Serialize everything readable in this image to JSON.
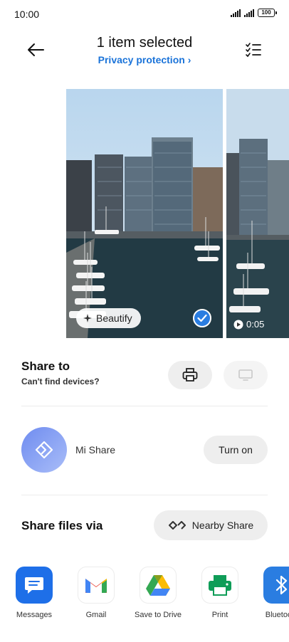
{
  "status_bar": {
    "time": "10:00",
    "battery": "100"
  },
  "header": {
    "title": "1 item selected",
    "subtitle": "Privacy protection",
    "back_icon": "back-arrow-icon",
    "select_all_icon": "checklist-icon"
  },
  "carousel": {
    "items": [
      {
        "type": "photo",
        "selected": true,
        "beautify_label": "Beautify"
      },
      {
        "type": "video",
        "duration": "0:05"
      }
    ]
  },
  "share_to": {
    "title": "Share to",
    "subtitle": "Can't find devices?",
    "print_icon": "printer-icon",
    "cast_icon": "monitor-icon"
  },
  "mi_share": {
    "label": "Mi Share",
    "button": "Turn on"
  },
  "share_files": {
    "title": "Share files via",
    "nearby_button": "Nearby Share"
  },
  "apps": [
    {
      "label": "Messages",
      "icon": "messages-icon"
    },
    {
      "label": "Gmail",
      "icon": "gmail-icon"
    },
    {
      "label": "Save to Drive",
      "icon": "google-drive-icon"
    },
    {
      "label": "Print",
      "icon": "printer-icon"
    },
    {
      "label": "Bluetooth",
      "icon": "bluetooth-icon"
    }
  ],
  "colors": {
    "accent": "#1a73d9",
    "check_badge": "#2a7de1"
  }
}
